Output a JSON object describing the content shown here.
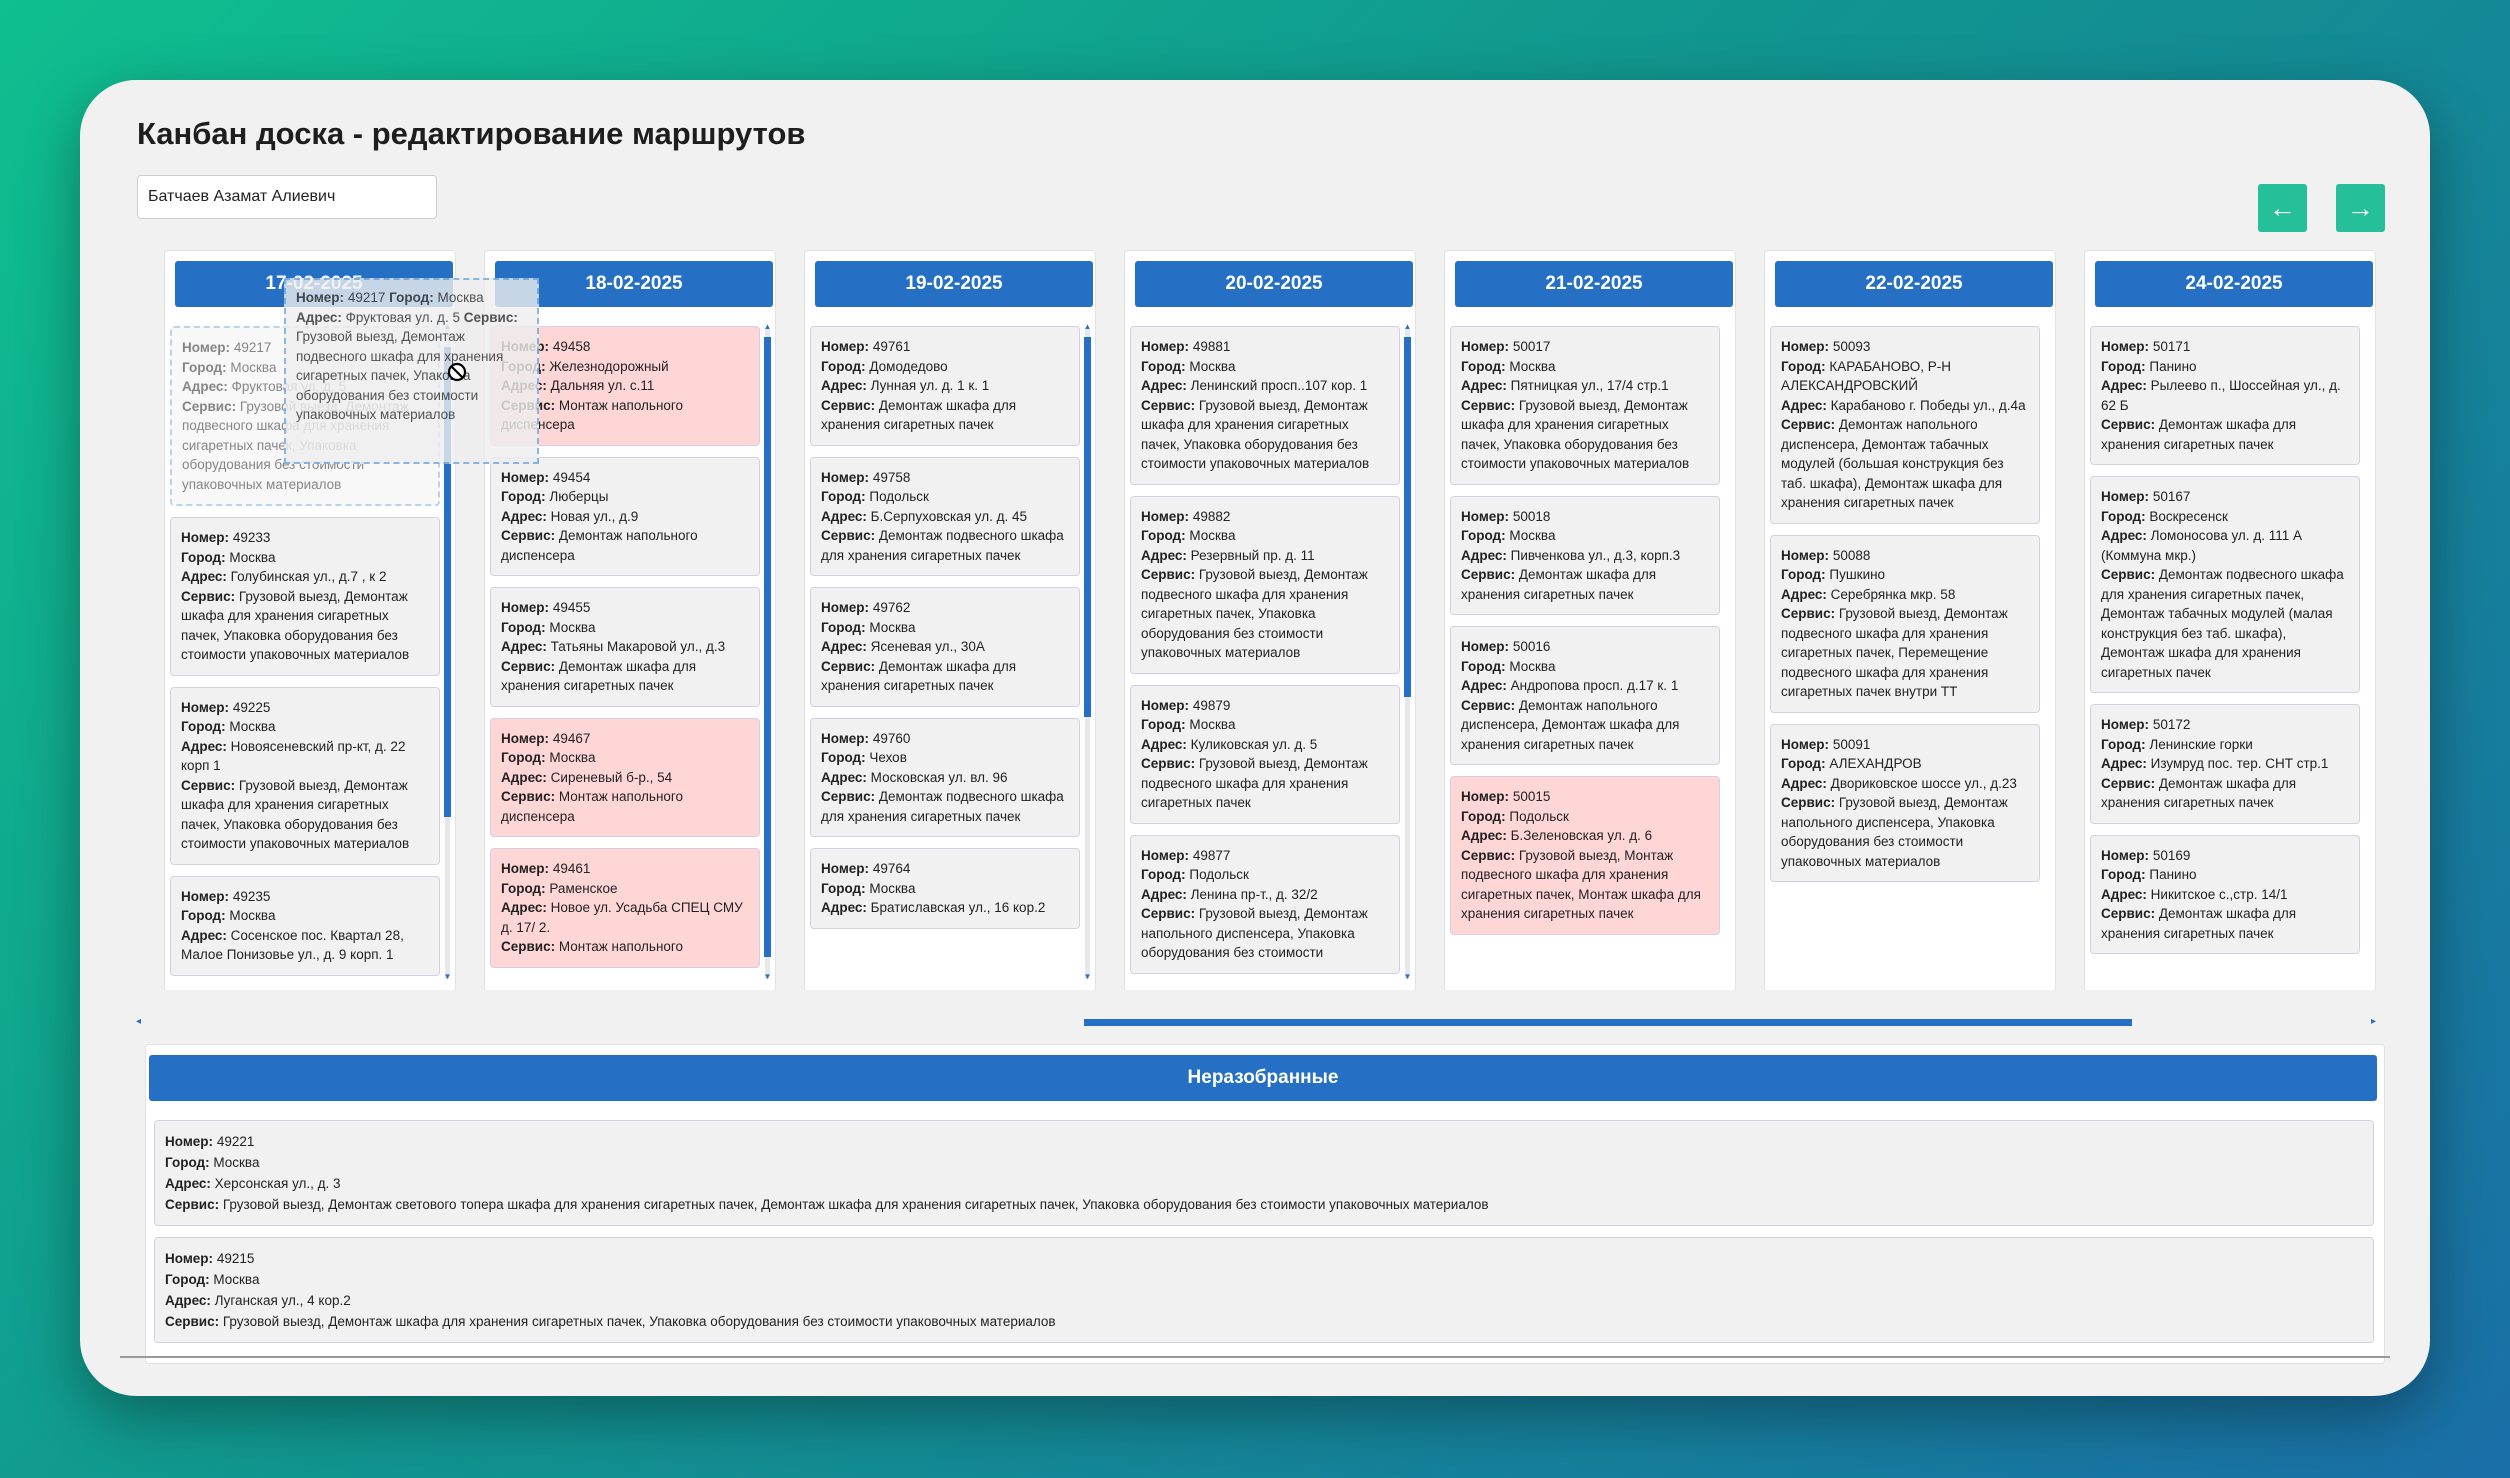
{
  "title": "Канбан доска - редактирование маршрутов",
  "assignee_value": "Батчаев Азамат Алиевич",
  "nav": {
    "prev": "←",
    "next": "→"
  },
  "labels": {
    "number": "Номер:",
    "city": "Город:",
    "address": "Адрес:",
    "service": "Сервис:"
  },
  "drag_ghost": {
    "number": "49217",
    "city": "Москва",
    "address": "Фруктовая ул. д. 5",
    "service": "Грузовой выезд, Демонтаж подвесного шкафа для хранения сигаретных пачек, Упаковка оборудования без стоимости упаковочных материалов"
  },
  "columns": [
    {
      "date": "17-02-2025",
      "cards": [
        {
          "placeholder": true,
          "number": "49217",
          "city": "Москва",
          "address": "Фруктовая ул. д. 5",
          "service": "Грузовой выезд, Демонтаж подвесного шкафа для хранения сигаретных пачек, Упаковка оборудования без стоимости упаковочных материалов"
        },
        {
          "number": "49233",
          "city": "Москва",
          "address": "Голубинская ул., д.7 , к 2",
          "service": "Грузовой выезд, Демонтаж шкафа для хранения сигаретных пачек, Упаковка оборудования без стоимости упаковочных материалов"
        },
        {
          "number": "49225",
          "city": "Москва",
          "address": "Новоясеневский пр-кт, д. 22 корп 1",
          "service": "Грузовой выезд, Демонтаж шкафа для хранения сигаретных пачек, Упаковка оборудования без стоимости упаковочных материалов"
        },
        {
          "number": "49235",
          "city": "Москва",
          "address": "Сосенское пос. Квартал 28, Малое Понизовье ул., д. 9 корп. 1",
          "service": ""
        }
      ]
    },
    {
      "date": "18-02-2025",
      "cards": [
        {
          "pink": true,
          "number": "49458",
          "city": "Железнодорожный",
          "address": "Дальняя ул. с.11",
          "service": "Монтаж напольного диспенсера"
        },
        {
          "number": "49454",
          "city": "Люберцы",
          "address": "Новая ул., д.9",
          "service": "Демонтаж напольного диспенсера"
        },
        {
          "number": "49455",
          "city": "Москва",
          "address": "Татьяны Макаровой ул., д.3",
          "service": "Демонтаж шкафа для хранения сигаретных пачек"
        },
        {
          "pink": true,
          "number": "49467",
          "city": "Москва",
          "address": "Сиреневый б-р., 54",
          "service": "Монтаж напольного диспенсера"
        },
        {
          "pink": true,
          "number": "49461",
          "city": "Раменское",
          "address": "Новое ул. Усадьба СПЕЦ СМУ д. 17/ 2.",
          "service": "Монтаж напольного"
        }
      ]
    },
    {
      "date": "19-02-2025",
      "cards": [
        {
          "number": "49761",
          "city": "Домодедово",
          "address": "Лунная ул. д. 1 к. 1",
          "service": "Демонтаж шкафа для хранения сигаретных пачек"
        },
        {
          "number": "49758",
          "city": "Подольск",
          "address": "Б.Серпуховская ул. д. 45",
          "service": "Демонтаж подвесного шкафа для хранения сигаретных пачек"
        },
        {
          "number": "49762",
          "city": "Москва",
          "address": "Ясеневая ул., 30А",
          "service": "Демонтаж шкафа для хранения сигаретных пачек"
        },
        {
          "number": "49760",
          "city": "Чехов",
          "address": "Московская ул. вл. 96",
          "service": "Демонтаж подвесного шкафа для хранения сигаретных пачек"
        },
        {
          "number": "49764",
          "city": "Москва",
          "address": "Братиславская ул., 16 кор.2",
          "service": ""
        }
      ]
    },
    {
      "date": "20-02-2025",
      "cards": [
        {
          "number": "49881",
          "city": "Москва",
          "address": "Ленинский просп..107 кор. 1",
          "service": "Грузовой выезд, Демонтаж шкафа для хранения сигаретных пачек, Упаковка оборудования без стоимости упаковочных материалов"
        },
        {
          "number": "49882",
          "city": "Москва",
          "address": "Резервный пр. д. 11",
          "service": "Грузовой выезд, Демонтаж подвесного шкафа для хранения сигаретных пачек, Упаковка оборудования без стоимости упаковочных материалов"
        },
        {
          "number": "49879",
          "city": "Москва",
          "address": "Куликовская ул. д. 5",
          "service": "Грузовой выезд, Демонтаж подвесного шкафа для хранения сигаретных пачек"
        },
        {
          "number": "49877",
          "city": "Подольск",
          "address": "Ленина пр-т., д. 32/2",
          "service": "Грузовой выезд, Демонтаж напольного диспенсера, Упаковка оборудования без стоимости"
        }
      ]
    },
    {
      "date": "21-02-2025",
      "cards": [
        {
          "number": "50017",
          "city": "Москва",
          "address": "Пятницкая ул., 17/4 стр.1",
          "service": "Грузовой выезд, Демонтаж шкафа для хранения сигаретных пачек, Упаковка оборудования без стоимости упаковочных материалов"
        },
        {
          "number": "50018",
          "city": "Москва",
          "address": "Пивченкова ул., д.3, корп.3",
          "service": "Демонтаж шкафа для хранения сигаретных пачек"
        },
        {
          "number": "50016",
          "city": "Москва",
          "address": "Андропова просп. д.17 к. 1",
          "service": "Демонтаж напольного диспенсера, Демонтаж шкафа для хранения сигаретных пачек"
        },
        {
          "pink": true,
          "number": "50015",
          "city": "Подольск",
          "address": "Б.Зеленовская ул. д. 6",
          "service": "Грузовой выезд, Монтаж подвесного шкафа для хранения сигаретных пачек, Монтаж шкафа для хранения сигаретных пачек"
        }
      ]
    },
    {
      "date": "22-02-2025",
      "cards": [
        {
          "number": "50093",
          "city": "КАРАБАНОВО, Р-Н АЛЕКСАНДРОВСКИЙ",
          "address": "Карабаново г. Победы ул., д.4а",
          "service": "Демонтаж напольного диспенсера, Демонтаж табачных модулей (большая конструкция без таб. шкафа), Демонтаж шкафа для хранения сигаретных пачек"
        },
        {
          "number": "50088",
          "city": "Пушкино",
          "address": "Серебрянка мкр. 58",
          "service": "Грузовой выезд, Демонтаж подвесного шкафа для хранения сигаретных пачек, Перемещение подвесного шкафа для хранения сигаретных пачек внутри ТТ"
        },
        {
          "number": "50091",
          "city": "АЛЕХАНДРОВ",
          "address": "Двориковское шоссе ул., д.23",
          "service": "Грузовой выезд, Демонтаж напольного диспенсера, Упаковка оборудования без стоимости упаковочных материалов"
        }
      ]
    },
    {
      "date": "24-02-2025",
      "cards": [
        {
          "number": "50171",
          "city": "Панино",
          "address": "Рылеево п., Шоссейная ул., д. 62 Б",
          "service": "Демонтаж шкафа для хранения сигаретных пачек"
        },
        {
          "number": "50167",
          "city": "Воскресенск",
          "address": "Ломоносова ул. д. 111 А (Коммуна мкр.)",
          "service": "Демонтаж подвесного шкафа для хранения сигаретных пачек, Демонтаж табачных модулей (малая конструкция без таб. шкафа), Демонтаж шкафа для хранения сигаретных пачек"
        },
        {
          "number": "50172",
          "city": "Ленинские горки",
          "address": "Изумруд пос. тер. СНТ стр.1",
          "service": "Демонтаж шкафа для хранения сигаретных пачек"
        },
        {
          "number": "50169",
          "city": "Панино",
          "address": "Никитское с.,стр. 14/1",
          "service": "Демонтаж шкафа для хранения сигаретных пачек"
        }
      ]
    }
  ],
  "unsorted": {
    "title": "Неразобранные",
    "cards": [
      {
        "number": "49221",
        "city": "Москва",
        "address": "Херсонская ул., д. 3",
        "service": "Грузовой выезд, Демонтаж светового топера шкафа для хранения сигаретных пачек, Демонтаж шкафа для хранения сигаретных пачек, Упаковка оборудования без стоимости упаковочных материалов"
      },
      {
        "number": "49215",
        "city": "Москва",
        "address": "Луганская ул., 4 кор.2",
        "service": "Грузовой выезд, Демонтаж шкафа для хранения сигаретных пачек, Упаковка оборудования без стоимости упаковочных материалов"
      }
    ]
  }
}
